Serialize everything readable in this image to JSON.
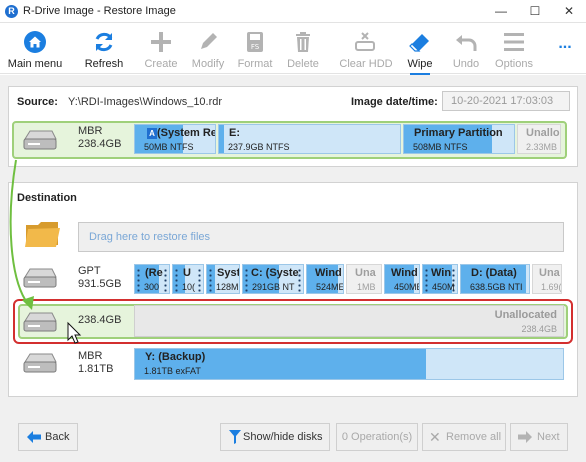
{
  "window": {
    "title": "R-Drive Image - Restore Image",
    "logo_letter": "R",
    "controls": {
      "minimize": "—",
      "maximize": "☐",
      "close": "✕"
    }
  },
  "toolbar": {
    "items": [
      {
        "label": "Main menu",
        "icon": "home-icon",
        "enabled": true
      },
      {
        "label": "Refresh",
        "icon": "refresh-icon",
        "enabled": true
      },
      {
        "label": "Create",
        "icon": "plus-icon",
        "enabled": false
      },
      {
        "label": "Modify",
        "icon": "pencil-icon",
        "enabled": false
      },
      {
        "label": "Format",
        "icon": "format-icon",
        "format_badge": "FS",
        "enabled": false
      },
      {
        "label": "Delete",
        "icon": "trash-icon",
        "enabled": false
      },
      {
        "label": "Clear HDD",
        "icon": "clear-hdd-icon",
        "enabled": false
      },
      {
        "label": "Wipe",
        "icon": "eraser-icon",
        "enabled": true,
        "active": true
      },
      {
        "label": "Undo",
        "icon": "undo-icon",
        "enabled": false
      },
      {
        "label": "Options",
        "icon": "hamburger-icon",
        "enabled": false
      }
    ],
    "more": "..."
  },
  "source": {
    "label": "Source:",
    "path": "Y:\\RDI-Images\\Windows_10.rdr",
    "date_label": "Image date/time:",
    "date_value": "10-20-2021 17:03:03",
    "disk": {
      "type": "MBR",
      "size": "238.4GB",
      "partitions": [
        {
          "name": "(System Re",
          "sub": "50MB NTFS",
          "fill": 0.6,
          "badge": "A"
        },
        {
          "name": "E:",
          "sub": "237.9GB NTFS",
          "fill": 0.03
        },
        {
          "name": "Primary Partition",
          "sub": "508MB NTFS",
          "fill": 0.8
        },
        {
          "name": "Unalloc",
          "sub": "2.33MB",
          "unallocated": true
        }
      ]
    }
  },
  "destination": {
    "title": "Destination",
    "dropzone_text": "Drag here to restore files",
    "disks": [
      {
        "type": "GPT",
        "size": "931.5GB",
        "partitions": [
          {
            "name": "(Re",
            "sub": "300",
            "fill": 0.7,
            "dots": true
          },
          {
            "name": "U",
            "sub": "10(",
            "fill": 0.4,
            "dots": true
          },
          {
            "name": "Syst",
            "sub": "128M",
            "fill": 0.25,
            "dots": true
          },
          {
            "name": "C: (Syste",
            "sub": "291GB NT",
            "fill": 0.6,
            "dots": true
          },
          {
            "name": "Wind",
            "sub": "524ME",
            "fill": 0.85
          },
          {
            "name": "Una",
            "sub": "1MB",
            "unallocated": true
          },
          {
            "name": "Wind",
            "sub": "450ME",
            "fill": 0.85
          },
          {
            "name": "Win",
            "sub": "450M",
            "fill": 0.85,
            "dots": true
          },
          {
            "name": "D: (Data)",
            "sub": "638.5GB NTI",
            "fill": 0.95
          },
          {
            "name": "Una",
            "sub": "1.69(",
            "unallocated": true
          }
        ]
      },
      {
        "size": "238.4GB",
        "selected": true,
        "partitions": [
          {
            "name": "Unallocated",
            "sub": "238.4GB",
            "unallocated": true
          }
        ]
      },
      {
        "type": "MBR",
        "size": "1.81TB",
        "partitions": [
          {
            "name": "Y: (Backup)",
            "sub": "1.81TB exFAT",
            "fill": 0.68
          }
        ]
      }
    ]
  },
  "footer": {
    "back": "Back",
    "show_hide": "Show/hide disks",
    "operations": "0 Operation(s)",
    "remove_all": "Remove all",
    "next": "Next"
  },
  "colors": {
    "accent": "#1b7ee0",
    "partition_fill": "#5eb0ec",
    "partition_bg": "#cfe6f8",
    "selected_green": "#e6f4dc",
    "selected_border": "#9fd07a",
    "highlight_red": "#d32f2f"
  }
}
